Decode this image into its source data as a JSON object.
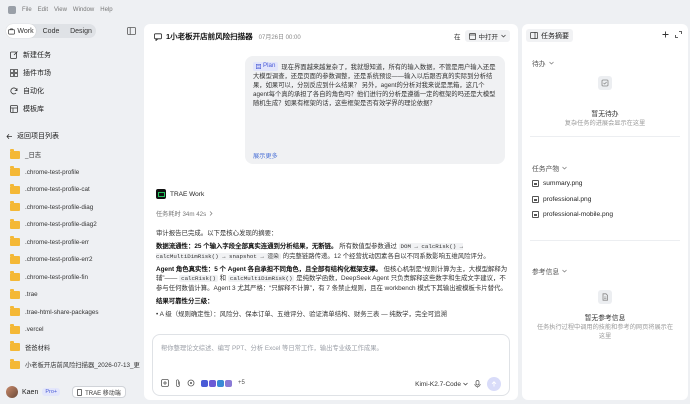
{
  "menu": [
    "File",
    "Edit",
    "View",
    "Window",
    "Help"
  ],
  "sidebar": {
    "modes": [
      "Work",
      "Code",
      "Design"
    ],
    "nav": [
      {
        "label": "新建任务",
        "icon": "pencil-square-icon"
      },
      {
        "label": "插件市场",
        "icon": "grid-icon"
      },
      {
        "label": "自动化",
        "icon": "refresh-icon"
      },
      {
        "label": "模板库",
        "icon": "template-icon"
      }
    ],
    "back_label": "返回项目列表",
    "projects": [
      "_日志",
      ".chrome-test-profile",
      ".chrome-test-profile-cat",
      ".chrome-test-profile-diag",
      ".chrome-test-profile-diag2",
      ".chrome-test-profile-err",
      ".chrome-test-profile-err2",
      ".chrome-test-profile-fin",
      ".trae",
      ".trae-html-share-packages",
      ".vercel",
      "爸爸材料",
      "小老板开店前风险扫描器_2026-07-13_更新"
    ],
    "user": {
      "name": "Kaen",
      "badge": "Pro+",
      "mobile_label": "TRAE 移动端"
    }
  },
  "main": {
    "title": "1小老板开店前风险扫描器",
    "date": "07月26日 00:00",
    "open_prefix": "在",
    "open_label": "中打开",
    "user_message": {
      "tag": "Plan",
      "text": "现在界面越来越复杂了，我就想知道，所有的输入数据，不管是用户输入还是大模型调查，还是页面的参数调整，还是系统预设——输入以后跟否真的实际到分析结果，如果可以，分别反应到什么结果？ 另外，agent的分析对我来说是黑箱，这几个agent每个真的承担了各自的角色吗？他们进行的分析是遵循一定的框架的吗还是大模型随机生成？如果有框架的话，这些框架是否有效学界的理论依据？",
      "more": "展示更多"
    },
    "agent_name": "TRAE Work",
    "elapsed": "任务耗时 34m 42s",
    "report": {
      "intro": "审计报告已完成。以下是核心发现的摘要：",
      "p1_bold": "数据流通性：25 个输入字段全部真实连通到分析结果，无断链。",
      "p1_text": "所有数值型参数通过",
      "p1_code1": "DOM → calcRisk() → calcMultiDimRisk() → snapshot → 渲染",
      "p1_tail": "的完整链路传递。12 个经营扰动因素各自以不同系数影响五维风险评分。",
      "p2_bold": "Agent 角色真实性：5 个 Agent 各自承担不同角色，且全部有结构化框架支撑。",
      "p2_text_a": "但核心机制是“规则计算为主，大模型解释为辅”——",
      "p2_code1": "calcRisk()",
      "p2_text_b": "和",
      "p2_code2": "calcMultiDimRisk()",
      "p2_text_c": "是纯数学函数，DeepSeek Agent 只负责解释这些数字和生成文字建议，不参与任何数值计算。Agent 3 尤其严格：“只解释不计算”，有 7 条禁止规则，且在 workbench 模式下其输出被模板卡片替代。",
      "p3_bold": "结果可靠性分三级：",
      "p3_item": "A 级（规则确定性）：风险分、保本订单、五维评分、验证清单结构、财务三表 — 纯数学，完全可追溯"
    },
    "composer": {
      "placeholder": "帮你整理论文综述、编写 PPT、分析 Excel 等日常工作，输出专业级工作成果。",
      "plus_count": "+5",
      "model": "Kimi-K2.7-Code"
    }
  },
  "right": {
    "tab": "任务摘要",
    "todo_title": "待办",
    "todo_empty_title": "暂无待办",
    "todo_empty_desc": "复杂任务的进展会显示在这里",
    "artifacts_title": "任务产物",
    "artifacts": [
      "summary.png",
      "professional.png",
      "professional-mobile.png"
    ],
    "refs_title": "参考信息",
    "refs_empty_title": "暂无参考信息",
    "refs_empty_desc": "任务执行过程中调用的技能和参考的网页将展示在这里"
  }
}
